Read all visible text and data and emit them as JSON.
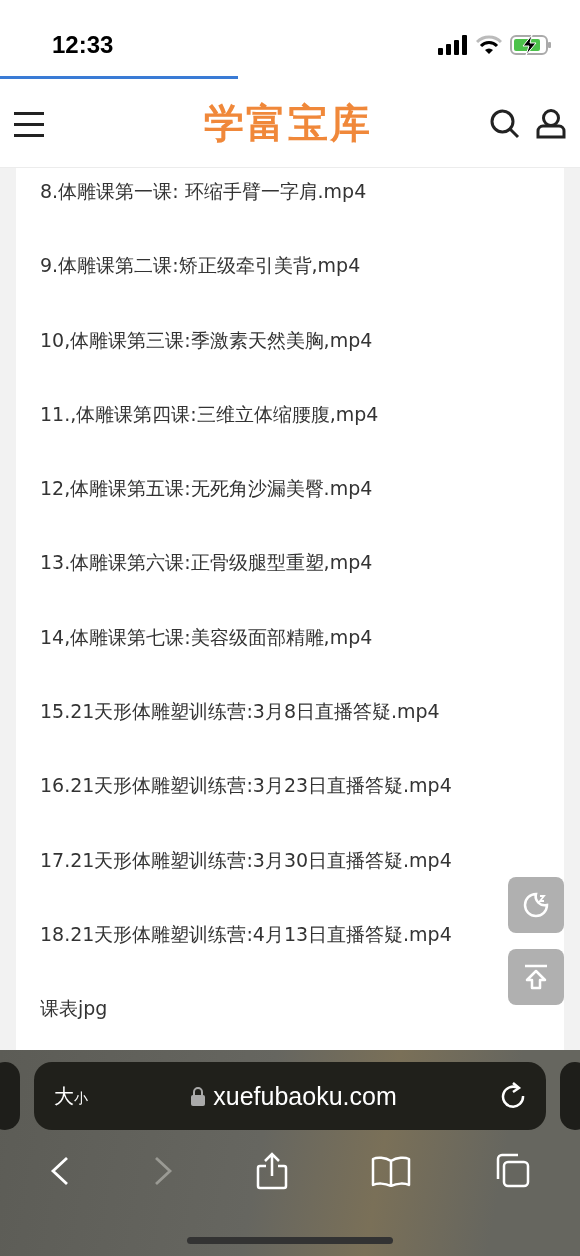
{
  "status_bar": {
    "time": "12:33"
  },
  "page_load": {
    "level": 0.41
  },
  "header": {
    "logo": "学富宝库"
  },
  "items": [
    {
      "text": "8.体雕课第一课: 环缩手臂一字肩.mp4"
    },
    {
      "text": "9.体雕课第二课:矫正级牵引美背,mp4"
    },
    {
      "text": "10,体雕课第三课:季激素天然美胸,mp4"
    },
    {
      "text": "11.,体雕课第四课:三维立体缩腰腹,mp4"
    },
    {
      "text": "12,体雕课第五课:无死角沙漏美臀.mp4"
    },
    {
      "text": "13.体雕课第六课:正骨级腿型重塑,mp4"
    },
    {
      "text": "14,体雕课第七课:美容级面部精雕,mp4"
    },
    {
      "text": "15.21天形体雕塑训练营:3月8日直播答疑.mp4"
    },
    {
      "text": "16.21天形体雕塑训练营:3月23日直播答疑.mp4"
    },
    {
      "text": "17.21天形体雕塑训练营:3月30日直播答疑.mp4"
    },
    {
      "text": "18.21天形体雕塑训练营:4月13日直播答疑.mp4"
    },
    {
      "text": "课表jpg"
    }
  ],
  "address_bar": {
    "text_size": {
      "large": "大",
      "small": "小"
    },
    "url": "xuefubaoku.com"
  },
  "toolbar": {
    "back": {
      "disabled": false
    },
    "forward": {
      "disabled": true
    }
  }
}
